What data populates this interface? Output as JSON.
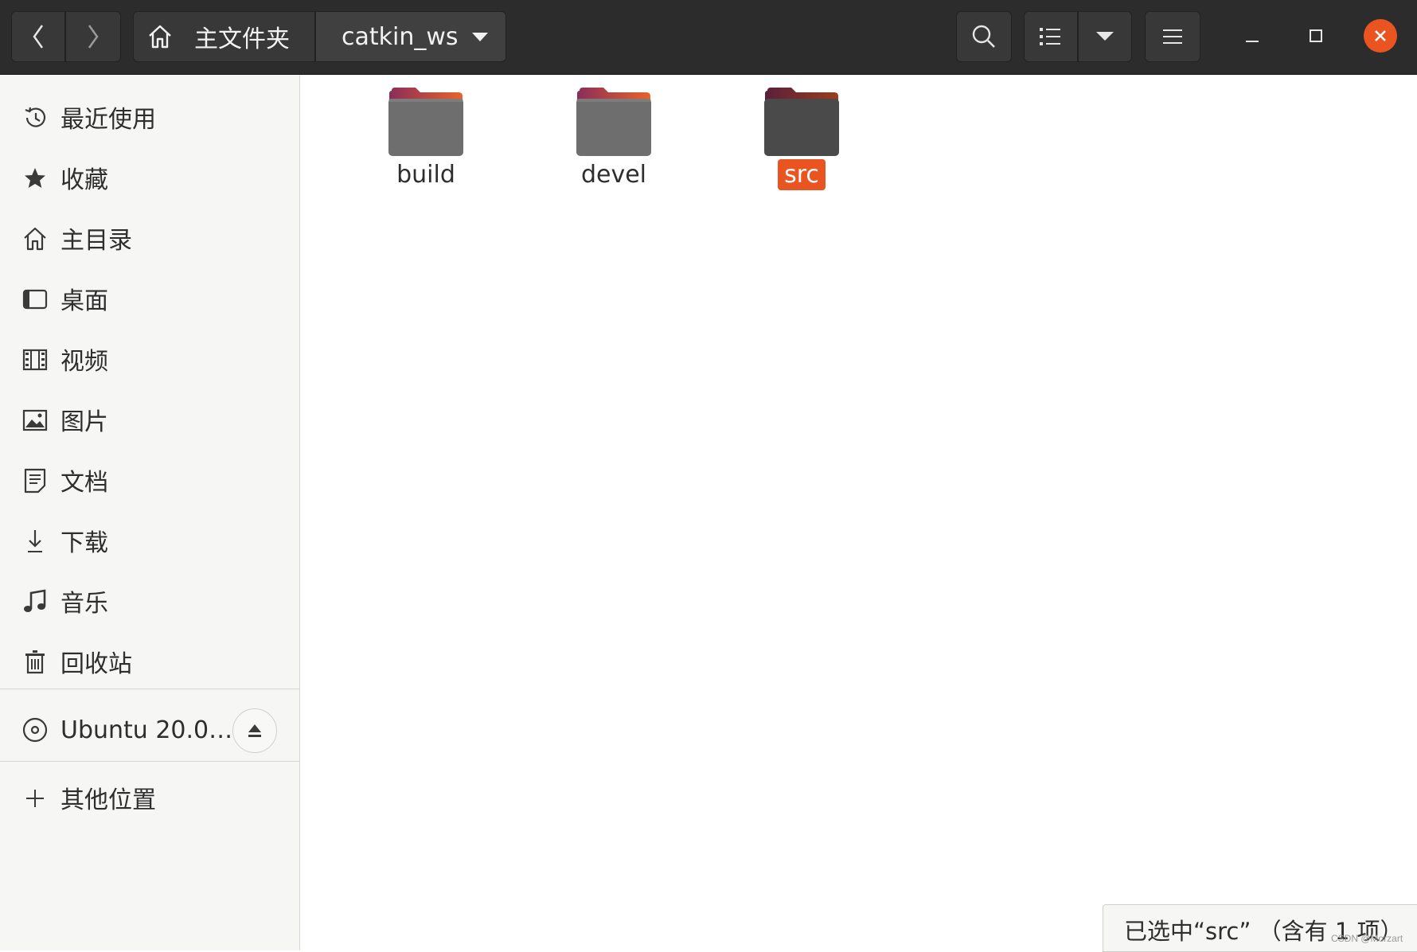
{
  "header": {
    "path": [
      {
        "label": "主文件夹",
        "icon": "home-icon"
      },
      {
        "label": "catkin_ws"
      }
    ],
    "icons": {
      "back": "chevron-left-icon",
      "forward": "chevron-right-icon",
      "path_menu": "caret-down-icon",
      "search": "search-icon",
      "view_list": "list-view-icon",
      "view_options": "caret-down-icon",
      "main_menu": "hamburger-menu-icon",
      "minimize": "minimize-icon",
      "maximize": "maximize-icon",
      "close": "close-icon"
    },
    "accent_close": "#e95420"
  },
  "sidebar": {
    "items": [
      {
        "label": "最近使用",
        "icon": "clock-icon"
      },
      {
        "label": "收藏",
        "icon": "star-icon"
      },
      {
        "label": "主目录",
        "icon": "home-icon"
      },
      {
        "label": "桌面",
        "icon": "desktop-icon"
      },
      {
        "label": "视频",
        "icon": "film-icon"
      },
      {
        "label": "图片",
        "icon": "image-icon"
      },
      {
        "label": "文档",
        "icon": "document-icon"
      },
      {
        "label": "下载",
        "icon": "download-icon"
      },
      {
        "label": "音乐",
        "icon": "music-icon"
      },
      {
        "label": "回收站",
        "icon": "trash-icon"
      }
    ],
    "devices": [
      {
        "label": "Ubuntu 20.0…",
        "icon": "disc-icon",
        "action_icon": "eject-icon"
      }
    ],
    "other_locations": {
      "label": "其他位置",
      "icon": "plus-icon"
    }
  },
  "files": [
    {
      "name": "build",
      "selected": false
    },
    {
      "name": "devel",
      "selected": false
    },
    {
      "name": "src",
      "selected": true
    }
  ],
  "selection_color": "#e95420",
  "status": "已选中“src” （含有 1 项）",
  "watermark": "CSDN @Morzart"
}
